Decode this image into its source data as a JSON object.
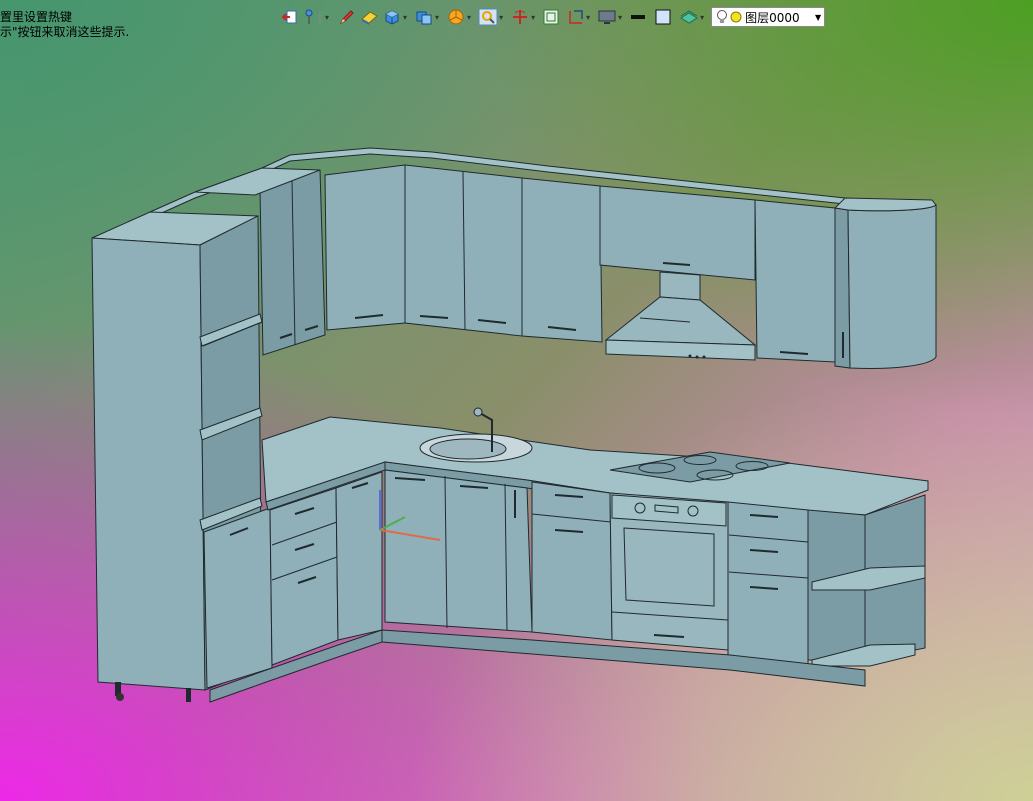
{
  "hint": {
    "line1": "置里设置热键",
    "line2": "示\"按钮来取消这些提示."
  },
  "toolbar": {
    "items": [
      {
        "icon": "exit-icon"
      },
      {
        "icon": "pin-icon",
        "dropdown": true
      },
      {
        "icon": "pencil-icon"
      },
      {
        "icon": "eraser-icon"
      },
      {
        "icon": "box-view-icon",
        "dropdown": true
      },
      {
        "icon": "layers-blocks-icon",
        "dropdown": true
      },
      {
        "icon": "pie-icon",
        "dropdown": true
      },
      {
        "icon": "zoom-icon",
        "dropdown": true
      },
      {
        "icon": "orbit-icon",
        "dropdown": true
      },
      {
        "icon": "frame-icon"
      },
      {
        "icon": "dimension-icon",
        "dropdown": true
      },
      {
        "icon": "monitor-icon",
        "dropdown": true
      },
      {
        "icon": "line-weight-icon"
      },
      {
        "icon": "color-swatch-icon"
      },
      {
        "icon": "material-icon",
        "dropdown": true
      }
    ],
    "layer": {
      "name": "图层0000",
      "icons": [
        "lightbulb-icon",
        "sun-icon"
      ]
    }
  },
  "colors": {
    "cabinet_fill": "#8fb0b8",
    "cabinet_top": "#a3c2c8",
    "cabinet_shadow": "#7a9aa3",
    "outline": "#1f2a2e",
    "glass": "#e8f0f4"
  }
}
